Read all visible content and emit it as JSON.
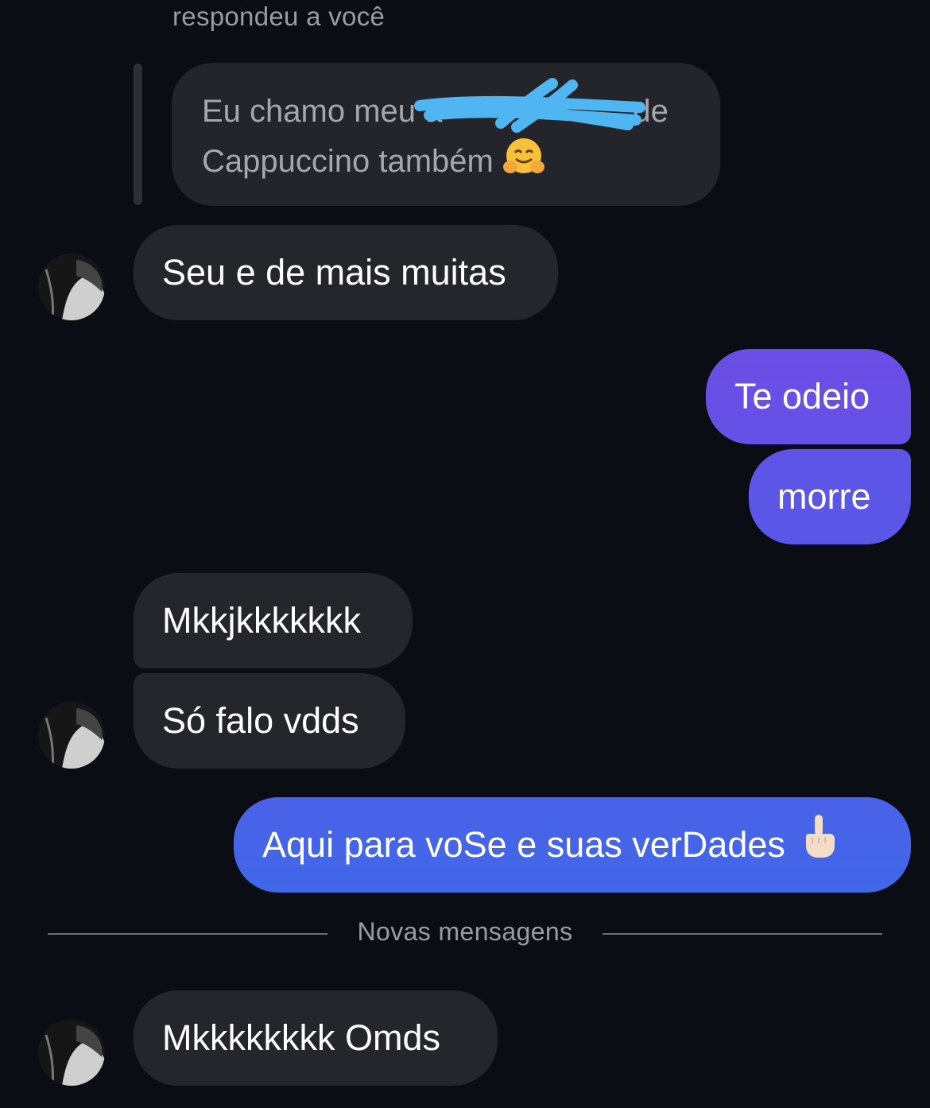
{
  "reply_header": "respondeu a você",
  "quoted_message": {
    "line1_start": "Eu chamo meu a",
    "line1_end": "de",
    "line2": "Cappuccino também",
    "emoji": "hugging-face-emoji"
  },
  "messages": [
    {
      "id": "m1",
      "side": "incoming",
      "text": "Seu e de mais muitas"
    },
    {
      "id": "m2",
      "side": "outgoing",
      "text": "Te odeio"
    },
    {
      "id": "m3",
      "side": "outgoing",
      "text": "morre"
    },
    {
      "id": "m4",
      "side": "incoming",
      "text": "Mkkjkkkkkkk"
    },
    {
      "id": "m5",
      "side": "incoming",
      "text": "Só falo vdds"
    },
    {
      "id": "m6",
      "side": "outgoing",
      "text": "Aqui para voSe e suas verDades",
      "emoji": "middle-finger-emoji"
    },
    {
      "id": "m7",
      "side": "incoming",
      "text": "Mkkkkkkkk Omds"
    }
  ],
  "new_messages_divider": "Novas mensagens",
  "colors": {
    "background": "#0b0d14",
    "incoming_bubble": "#24262c",
    "outgoing_gradient_top": "#6a4ee6",
    "outgoing_gradient_bottom": "#4167e8",
    "redaction_scribble": "#4fb6f2"
  }
}
